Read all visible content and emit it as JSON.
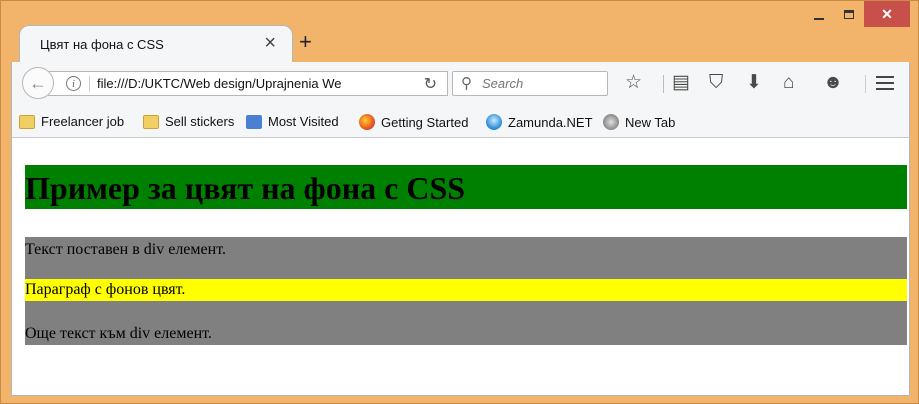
{
  "browser": {
    "tab_title": "Цвят на фона с CSS",
    "url": "file:///D:/UKTC/Web design/Uprajnenia We",
    "search_placeholder": "Search"
  },
  "bookmarks": [
    {
      "label": "Freelancer job",
      "icon": "folder-icon"
    },
    {
      "label": "Sell stickers",
      "icon": "folder-icon"
    },
    {
      "label": "Most Visited",
      "icon": "most-visited-icon"
    },
    {
      "label": "Getting Started",
      "icon": "firefox-icon"
    },
    {
      "label": "Zamunda.NET",
      "icon": "zamunda-icon"
    },
    {
      "label": "New Tab",
      "icon": "globe-icon"
    }
  ],
  "page": {
    "heading": "Пример за цвят на фона с CSS",
    "div_text_1": "Текст поставен в div елемент.",
    "paragraph": "Параграф с фонов цвят.",
    "div_text_2": "Още текст към div елемент.",
    "colors": {
      "heading_bg": "#008000",
      "div_bg": "#808080",
      "paragraph_bg": "#ffff00"
    }
  }
}
